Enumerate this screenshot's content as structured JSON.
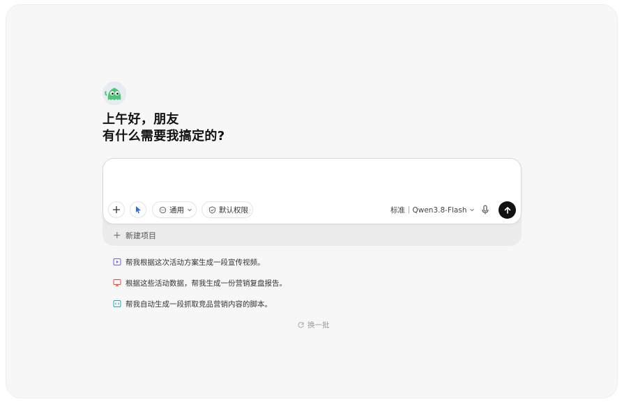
{
  "greeting": {
    "line1": "上午好，朋友",
    "line2": "有什么需要我搞定的?"
  },
  "composer": {
    "input_value": "",
    "placeholder": "",
    "toolbar": {
      "add_icon": "plus-icon",
      "cursor_icon": "cursor-icon",
      "mode_label": "通用",
      "permission_label": "默认权限",
      "model_label": "标准｜Qwen3.8-Flash",
      "mic_icon": "mic-icon",
      "send_icon": "arrow-up-icon"
    }
  },
  "project": {
    "new_label": "新建项目"
  },
  "suggestions": [
    {
      "icon": "video-icon",
      "color": "#6b63d6",
      "text": "帮我根据这次活动方案生成一段宣传视频。"
    },
    {
      "icon": "presentation-icon",
      "color": "#e5483b",
      "text": "根据这些活动数据，帮我生成一份营销复盘报告。"
    },
    {
      "icon": "code-icon",
      "color": "#21a3b8",
      "text": "帮我自动生成一段抓取竞品营销内容的脚本。"
    }
  ],
  "refresh_label": "换一批",
  "colors": {
    "background": "#f7f7f7",
    "send_button": "#111111",
    "accent_blue": "#2f6bf2",
    "avatar_green": "#4cc77a"
  }
}
